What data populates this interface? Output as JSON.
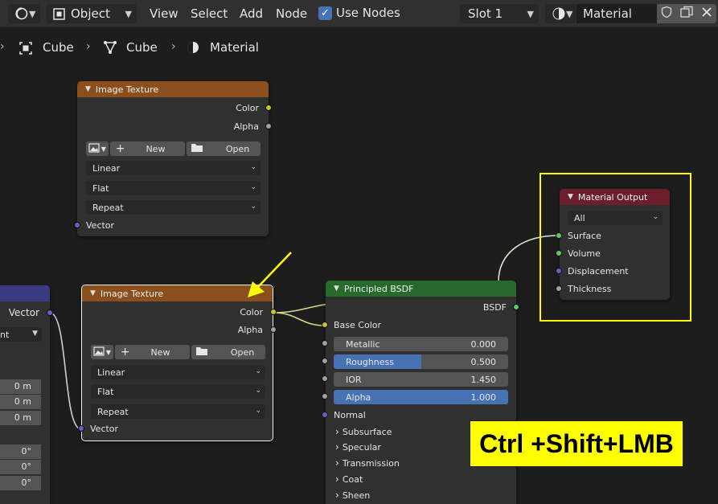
{
  "header": {
    "mode": "Object",
    "menus": [
      "View",
      "Select",
      "Add",
      "Node"
    ],
    "use_nodes": "Use Nodes",
    "slot": "Slot 1",
    "material": "Material"
  },
  "breadcrumb": [
    "Cube",
    "Cube",
    "Material"
  ],
  "nodes": {
    "image_texture_1": {
      "title": "Image Texture",
      "outputs": [
        "Color",
        "Alpha"
      ],
      "new": "New",
      "open": "Open",
      "interpolation": "Linear",
      "projection": "Flat",
      "extension": "Repeat",
      "input": "Vector"
    },
    "image_texture_2": {
      "title": "Image Texture",
      "outputs": [
        "Color",
        "Alpha"
      ],
      "new": "New",
      "open": "Open",
      "interpolation": "Linear",
      "projection": "Flat",
      "extension": "Repeat",
      "input": "Vector"
    },
    "principled": {
      "title": "Principled BSDF",
      "output": "BSDF",
      "base_color": "Base Color",
      "fields": [
        {
          "label": "Metallic",
          "value": "0.000"
        },
        {
          "label": "Roughness",
          "value": "0.500"
        },
        {
          "label": "IOR",
          "value": "1.450"
        },
        {
          "label": "Alpha",
          "value": "1.000"
        }
      ],
      "normal": "Normal",
      "panels": [
        "Subsurface",
        "Specular",
        "Transmission",
        "Coat",
        "Sheen"
      ]
    },
    "material_output": {
      "title": "Material Output",
      "target": "All",
      "inputs": [
        "Surface",
        "Volume",
        "Displacement",
        "Thickness"
      ]
    },
    "left_partial": {
      "output": "Vector",
      "dropdown": "nt",
      "values": [
        "0 m",
        "0 m",
        "0 m",
        "0°",
        "0°",
        "0°"
      ]
    }
  },
  "annotation": {
    "shortcut": "Ctrl +Shift+LMB"
  },
  "colors": {
    "header_orange": "#8a4f1d",
    "header_green": "#286a2c",
    "header_red": "#6b1f2d",
    "socket_yellow": "#c7c729",
    "socket_grey": "#a1a1a1",
    "socket_purple": "#6363c7",
    "socket_green": "#63c763",
    "highlight_yellow": "#ffff00",
    "field_blue": "#4772b3"
  },
  "roughness_fraction": 0.5
}
